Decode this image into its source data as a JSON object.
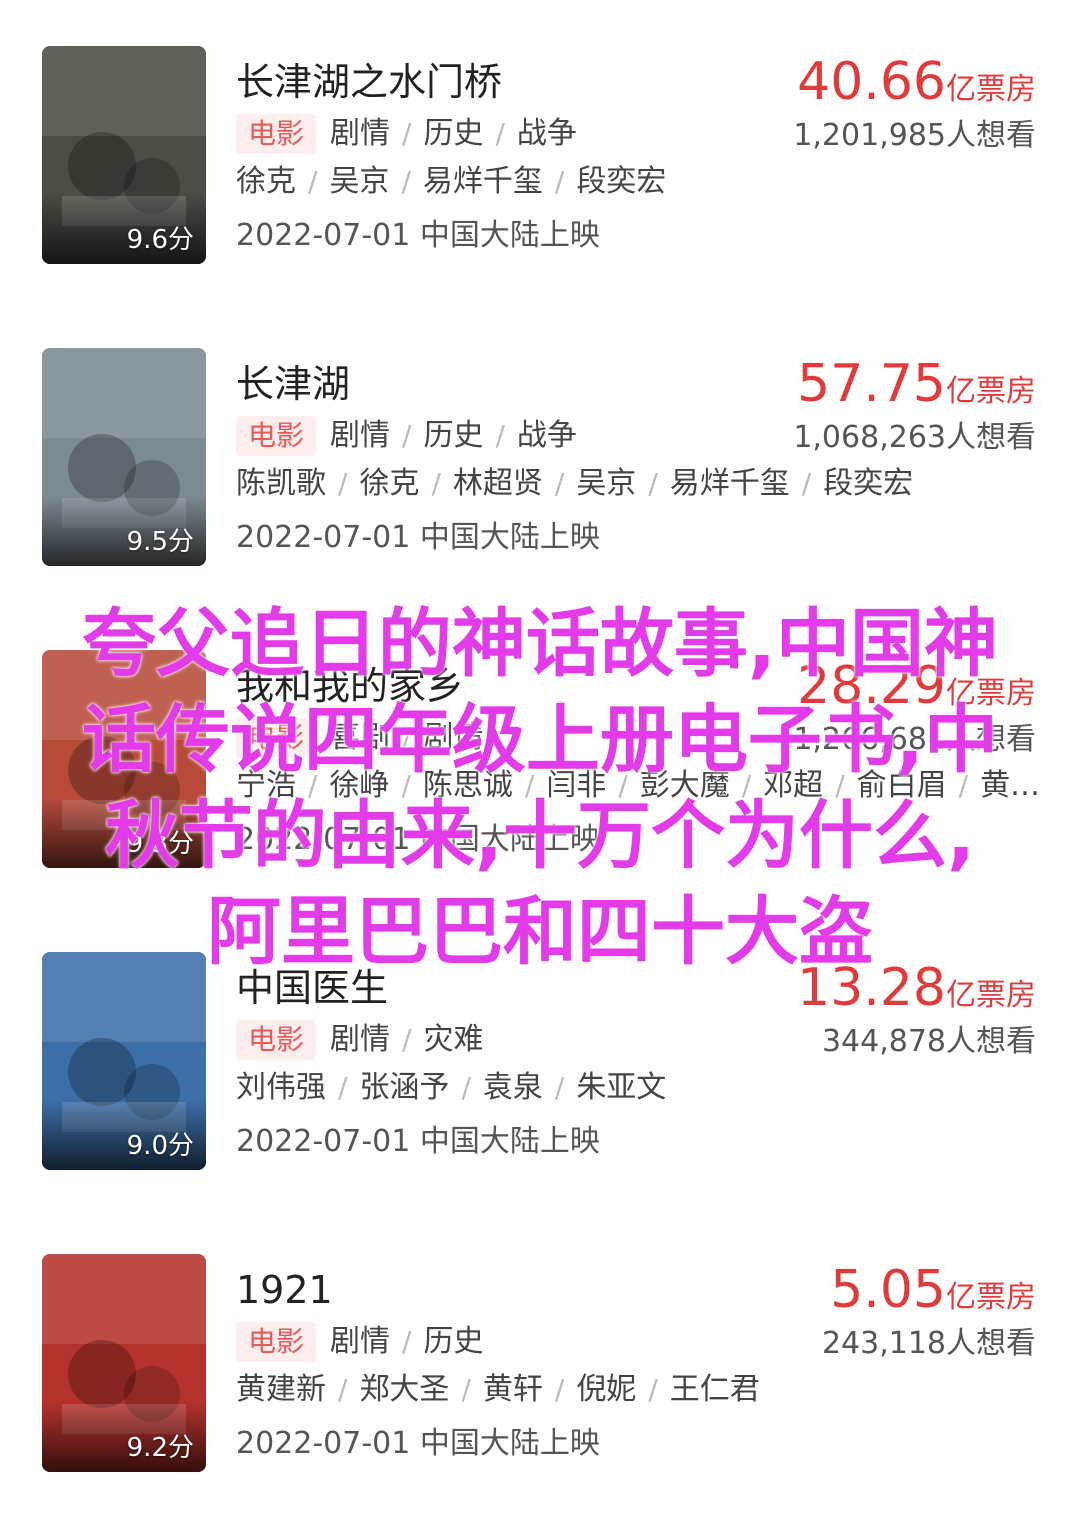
{
  "movies": [
    {
      "title": "长津湖之水门桥",
      "score": "9.6分",
      "tag": "电影",
      "genres": [
        "剧情",
        "历史",
        "战争"
      ],
      "cast": [
        "徐克",
        "吴京",
        "易烊千玺",
        "段奕宏"
      ],
      "release": "2022-07-01 中国大陆上映",
      "box_office": "40.66",
      "box_unit": "亿票房",
      "want": "1,201,985人想看",
      "poster_color": "#4e4a44"
    },
    {
      "title": "长津湖",
      "score": "9.5分",
      "tag": "电影",
      "genres": [
        "剧情",
        "历史",
        "战争"
      ],
      "cast": [
        "陈凯歌",
        "徐克",
        "林超贤",
        "吴京",
        "易烊千玺",
        "段奕宏"
      ],
      "release": "2022-07-01 中国大陆上映",
      "box_office": "57.75",
      "box_unit": "亿票房",
      "want": "1,068,263人想看",
      "poster_color": "#7c8a92"
    },
    {
      "title": "我和我的家乡",
      "score": "9.3分",
      "tag": "电影",
      "genres": [
        "喜剧",
        "剧情"
      ],
      "cast": [
        "宁浩",
        "徐峥",
        "陈思诚",
        "闫非",
        "彭大魔",
        "邓超",
        "俞白眉",
        "黄…"
      ],
      "release": "2022-07-01 中国大陆上映",
      "box_office": "28.29",
      "box_unit": "亿票房",
      "want": "1,266,681人想看",
      "poster_color": "#b84a3a"
    },
    {
      "title": "中国医生",
      "score": "9.0分",
      "tag": "电影",
      "genres": [
        "剧情",
        "灾难"
      ],
      "cast": [
        "刘伟强",
        "张涵予",
        "袁泉",
        "朱亚文"
      ],
      "release": "2022-07-01 中国大陆上映",
      "box_office": "13.28",
      "box_unit": "亿票房",
      "want": "344,878人想看",
      "poster_color": "#3c6ea8"
    },
    {
      "title": "1921",
      "score": "9.2分",
      "tag": "电影",
      "genres": [
        "剧情",
        "历史"
      ],
      "cast": [
        "黄建新",
        "郑大圣",
        "黄轩",
        "倪妮",
        "王仁君"
      ],
      "release": "2022-07-01 中国大陆上映",
      "box_office": "5.05",
      "box_unit": "亿票房",
      "want": "243,118人想看",
      "poster_color": "#b5322c"
    }
  ],
  "overlay_lines": [
    "夸父追日的神话故事,中国神",
    "话传说四年级上册电子书,中",
    "秋节的由来,十万个为什么,",
    "阿里巴巴和四十大盗"
  ],
  "overlay_color": "#e33be9",
  "accent": "#e23a3a",
  "tag_bg": "#fdeeee",
  "tag_color": "#e8595a"
}
